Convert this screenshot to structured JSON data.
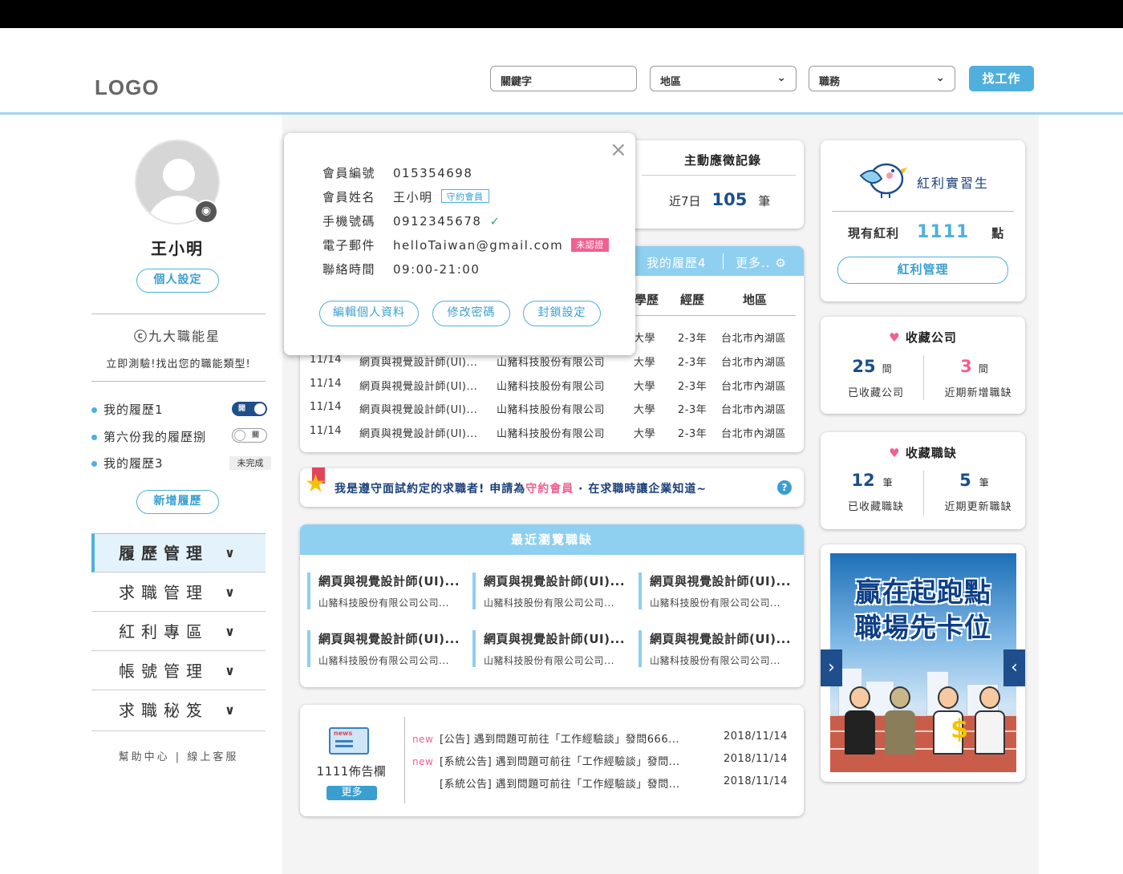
{
  "header": {
    "logo": "LOGO",
    "keyword_placeholder": "關鍵字",
    "region_select": "地區",
    "job_select": "職務",
    "search_button": "找工作"
  },
  "profile": {
    "name": "王小明",
    "settings_button": "個人設定",
    "star_title": "九大職能星",
    "star_subtitle": "立即測驗!找出您的職能類型!",
    "resumes": [
      {
        "label": "我的履歷1",
        "toggle": "開"
      },
      {
        "label": "第六份我的履歷捌",
        "toggle": "關"
      },
      {
        "label": "我的履歷3",
        "status": "未完成"
      }
    ],
    "add_resume_button": "新增履歷",
    "menu": [
      {
        "label": "履歷管理"
      },
      {
        "label": "求職管理"
      },
      {
        "label": "紅利專區"
      },
      {
        "label": "帳號管理"
      },
      {
        "label": "求職秘笈"
      }
    ],
    "help_links": "幫助中心 | 線上客服"
  },
  "popup": {
    "fields": [
      {
        "label": "會員編號",
        "value": "015354698"
      },
      {
        "label": "會員姓名",
        "value": "王小明",
        "tag": "守約會員"
      },
      {
        "label": "手機號碼",
        "value": "0912345678",
        "verified": "✓"
      },
      {
        "label": "電子郵件",
        "value": "helloTaiwan@gmail.com",
        "tag": "未認證"
      },
      {
        "label": "聯絡時間",
        "value": "09:00-21:00"
      }
    ],
    "buttons": [
      "編輯個人資料",
      "修改密碼",
      "封鎖設定"
    ],
    "close": "×"
  },
  "applications": {
    "title": "主動應徵記錄",
    "period": "近7日",
    "count": "105",
    "unit": "筆"
  },
  "resume_table": {
    "tab": "我的履歷4",
    "more": "更多..",
    "headers": [
      "學歷",
      "經歷",
      "地區"
    ],
    "rows": [
      {
        "date": "",
        "job": "",
        "company": "",
        "edu": "大學",
        "exp": "2-3年",
        "area": "台北市內湖區"
      },
      {
        "date": "11/14",
        "job": "網頁與視覺設計師(UI)...",
        "company": "山豬科技股份有限公司",
        "edu": "大學",
        "exp": "2-3年",
        "area": "台北市內湖區"
      },
      {
        "date": "11/14",
        "job": "網頁與視覺設計師(UI)...",
        "company": "山豬科技股份有限公司",
        "edu": "大學",
        "exp": "2-3年",
        "area": "台北市內湖區"
      },
      {
        "date": "11/14",
        "job": "網頁與視覺設計師(UI)...",
        "company": "山豬科技股份有限公司",
        "edu": "大學",
        "exp": "2-3年",
        "area": "台北市內湖區"
      },
      {
        "date": "11/14",
        "job": "網頁與視覺設計師(UI)...",
        "company": "山豬科技股份有限公司",
        "edu": "大學",
        "exp": "2-3年",
        "area": "台北市內湖區"
      }
    ]
  },
  "notice": {
    "text_a": "我是遵守面試約定的求職者!  申請為",
    "text_b": "守約會員",
    "text_c": " · 在求職時讓企業知道~",
    "help": "?"
  },
  "recent": {
    "title": "最近瀏覽職缺",
    "items": [
      {
        "title": "網頁與視覺設計師(UI)...",
        "company": "山豬科技股份有限公司公司..."
      },
      {
        "title": "網頁與視覺設計師(UI)...",
        "company": "山豬科技股份有限公司公司..."
      },
      {
        "title": "網頁與視覺設計師(UI)...",
        "company": "山豬科技股份有限公司公司..."
      },
      {
        "title": "網頁與視覺設計師(UI)...",
        "company": "山豬科技股份有限公司公司..."
      },
      {
        "title": "網頁與視覺設計師(UI)...",
        "company": "山豬科技股份有限公司公司..."
      },
      {
        "title": "網頁與視覺設計師(UI)...",
        "company": "山豬科技股份有限公司公司..."
      }
    ]
  },
  "board": {
    "icon_text": "news",
    "title": "1111佈告欄",
    "more": "更多",
    "items": [
      {
        "new": "new",
        "text": "[公告] 遇到問題可前往「工作經驗談」發問666...",
        "date": "2018/11/14"
      },
      {
        "new": "new",
        "text": "[系統公告] 遇到問題可前往「工作經驗談」發問...",
        "date": "2018/11/14"
      },
      {
        "new": "",
        "text": "[系統公告] 遇到問題可前往「工作經驗談」發問...",
        "date": "2018/11/14"
      }
    ]
  },
  "bonus": {
    "title": "紅利實習生",
    "label": "現有紅利",
    "points": "1111",
    "unit": "點",
    "button": "紅利管理"
  },
  "fav_company": {
    "title": "收藏公司",
    "saved_num": "25",
    "saved_unit": "間",
    "saved_label": "已收藏公司",
    "new_num": "3",
    "new_unit": "間",
    "new_label": "近期新增職缺"
  },
  "fav_jobs": {
    "title": "收藏職缺",
    "saved_num": "12",
    "saved_unit": "筆",
    "saved_label": "已收藏職缺",
    "new_num": "5",
    "new_unit": "筆",
    "new_label": "近期更新職缺"
  },
  "banner": {
    "line1": "贏在起跑點",
    "line2": "職場先卡位"
  }
}
